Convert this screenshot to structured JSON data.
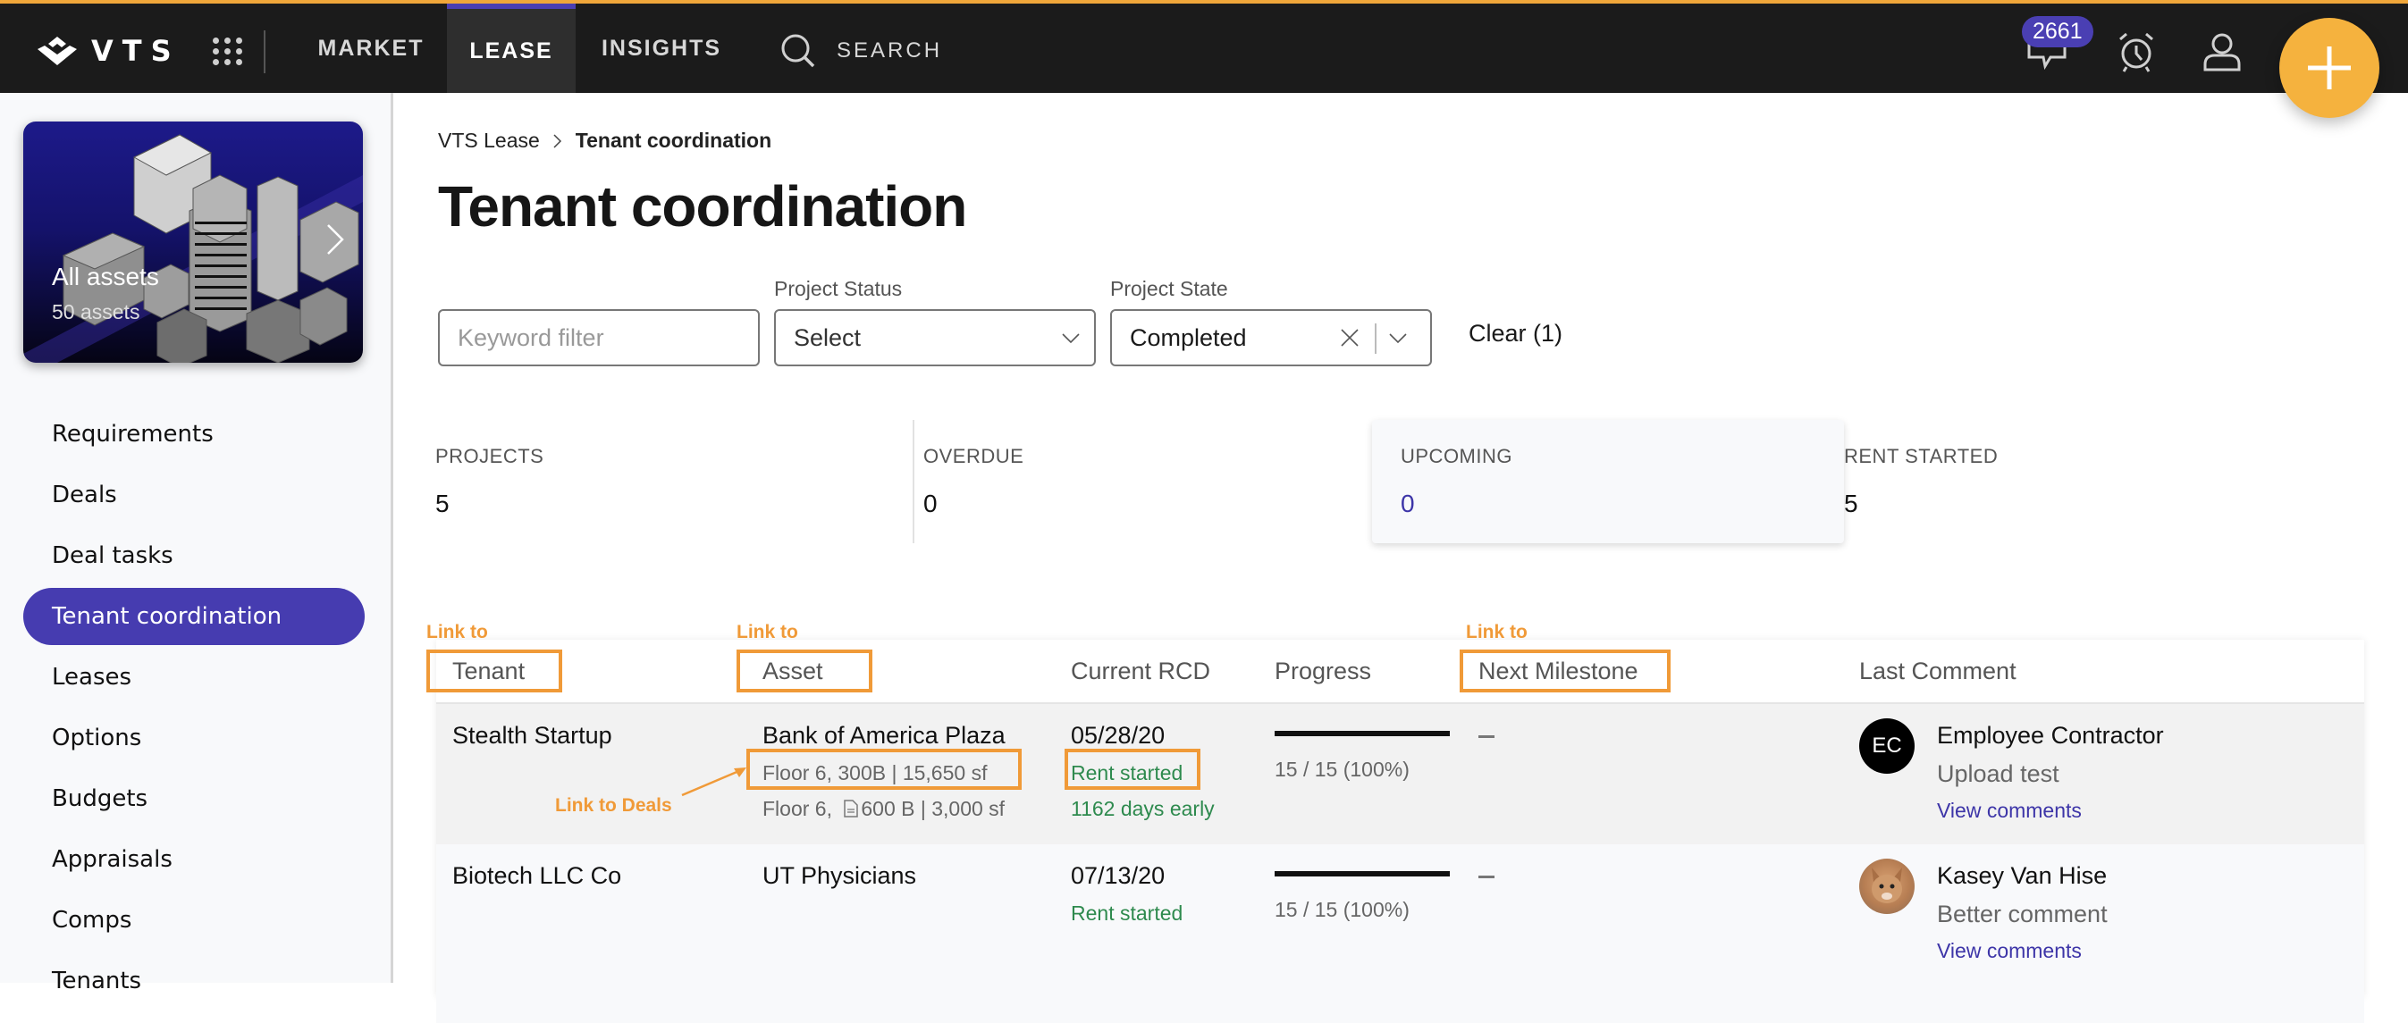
{
  "header": {
    "logo_text": "VTS",
    "nav": [
      {
        "label": "MARKET",
        "active": false
      },
      {
        "label": "LEASE",
        "active": true
      },
      {
        "label": "INSIGHTS",
        "active": false
      }
    ],
    "search_label": "SEARCH",
    "notification_count": "2661",
    "accent_color": "#f0a73a",
    "brand_color": "#463cb0"
  },
  "sidebar": {
    "asset_card": {
      "title": "All assets",
      "count": "50 assets"
    },
    "items": [
      {
        "label": "Requirements"
      },
      {
        "label": "Deals"
      },
      {
        "label": "Deal tasks"
      },
      {
        "label": "Tenant coordination",
        "active": true
      },
      {
        "label": "Leases"
      },
      {
        "label": "Options"
      },
      {
        "label": "Budgets"
      },
      {
        "label": "Appraisals"
      },
      {
        "label": "Comps"
      },
      {
        "label": "Tenants"
      }
    ]
  },
  "breadcrumb": {
    "parent": "VTS Lease",
    "current": "Tenant coordination"
  },
  "page_title": "Tenant coordination",
  "filters": {
    "keyword_placeholder": "Keyword filter",
    "project_status": {
      "label": "Project Status",
      "value": "Select"
    },
    "project_state": {
      "label": "Project State",
      "value": "Completed"
    },
    "clear_label": "Clear (1)"
  },
  "stats": [
    {
      "label": "PROJECTS",
      "value": "5"
    },
    {
      "label": "OVERDUE",
      "value": "0"
    },
    {
      "label": "UPCOMING",
      "value": "0"
    },
    {
      "label": "RENT STARTED",
      "value": "5"
    }
  ],
  "table": {
    "columns": [
      "Tenant",
      "Asset",
      "Current RCD",
      "Progress",
      "Next Milestone",
      "Last Comment"
    ],
    "rows": [
      {
        "tenant": "Stealth Startup",
        "asset": "Bank of America Plaza",
        "spaces": [
          "Floor 6, 300B | 15,650 sf",
          "Floor 6,",
          "600 B | 3,000 sf"
        ],
        "rcd": "05/28/20",
        "rcd_status": "Rent started",
        "rcd_note": "1162 days early",
        "progress_text": "15 / 15 (100%)",
        "progress_fraction": 1.0,
        "next_milestone": "—",
        "comment_author": "Employee Contractor",
        "comment_initials": "EC",
        "comment_text": "Upload test",
        "comment_link": "View comments"
      },
      {
        "tenant": "Biotech LLC Co",
        "asset": "UT Physicians",
        "rcd": "07/13/20",
        "rcd_status": "Rent started",
        "progress_text": "15 / 15 (100%)",
        "progress_fraction": 1.0,
        "next_milestone": "—",
        "comment_author": "Kasey Van Hise",
        "comment_text": "Better comment",
        "comment_link": "View comments"
      }
    ]
  },
  "annotations": {
    "tenant": "Link to",
    "asset": "Link to",
    "milestone": "Link to",
    "deals": "Link to Deals",
    "color": "#f09a38"
  }
}
